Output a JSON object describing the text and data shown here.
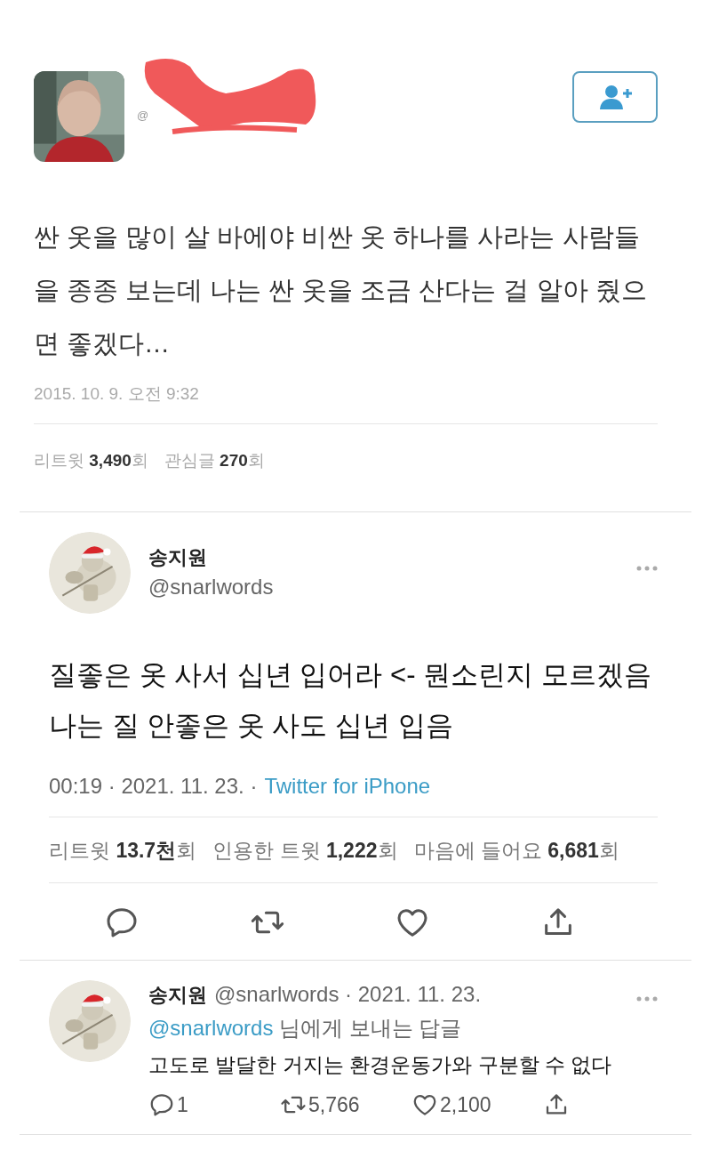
{
  "tweet": {
    "handle": "@",
    "text": "싼 옷을 많이 살 바에야 비싼 옷 하나를 사라는 사람들을 종종 보는데 나는 싼 옷을 조금 산다는 걸 알아 줬으면 좋겠다…",
    "timestamp": "2015. 10. 9. 오전 9:32",
    "stats": [
      "리트윗 **3,490**회",
      "관심글 **270**회"
    ]
  },
  "quote_tweet": {
    "name": "송지원",
    "handle": "@snarlwords",
    "text": "질좋은 옷 사서 십년 입어라 <- 뭔소린지 모르겠음 나는 질 안좋은 옷 사도 십년 입음",
    "time": "00:19 · 2021. 11. 23. ·",
    "source": "Twitter for iPhone",
    "stats": [
      "리트윗 **13.7천**회",
      "인용한 트윗 **1,222**회",
      "마음에 들어요 **6,681**회"
    ],
    "actions": [
      {
        "kind": "reply"
      },
      {
        "kind": "retweet"
      },
      {
        "kind": "like"
      },
      {
        "kind": "share"
      }
    ]
  },
  "reply": {
    "name": "송지원",
    "meta": "@snarlwords · 2021. 11. 23.",
    "reply_to_handle": "@snarlwords",
    "reply_to_suffix": "님에게 보내는 답글",
    "text": "고도로 발달한 거지는 환경운동가와 구분할 수 없다",
    "actions": [
      {
        "kind": "reply",
        "count": "1"
      },
      {
        "kind": "retweet",
        "count": "5,766"
      },
      {
        "kind": "like",
        "count": "2,100"
      },
      {
        "kind": "share"
      }
    ]
  }
}
